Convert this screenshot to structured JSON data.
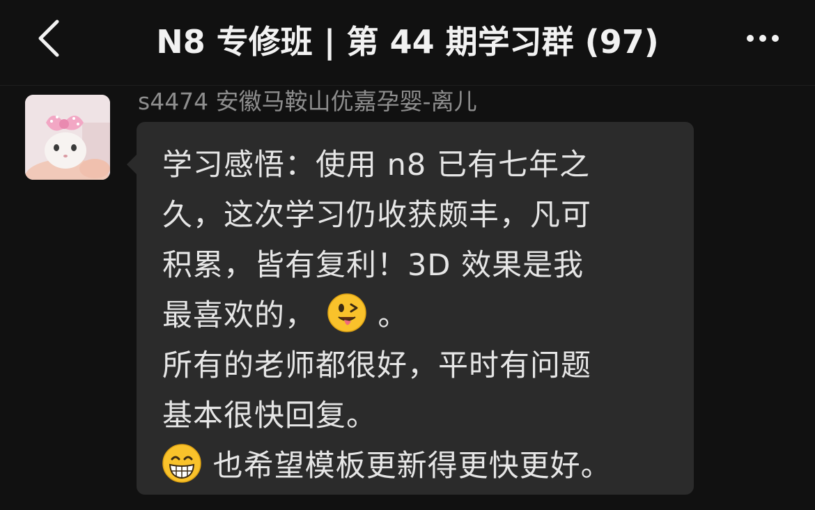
{
  "header": {
    "title": "N8 专修班 | 第 44 期学习群 (97)"
  },
  "message": {
    "sender": "s4474 安徽马鞍山优嘉孕婴-离儿",
    "lines": {
      "l1": "学习感悟：使用 n8 已有七年之",
      "l2": "久，这次学习仍收获颇丰，凡可",
      "l3": "积累，皆有复利！3D 效果是我",
      "l4": "最喜欢的，",
      "l4_end": "。",
      "l5": "所有的老师都很好，平时有问题",
      "l6": "基本很快回复。",
      "l7": "也希望模板更新得更快更好。"
    },
    "emojis": {
      "wink": "winking-face-with-tongue-icon",
      "grin": "grinning-face-icon"
    }
  },
  "colors": {
    "background": "#111111",
    "bubble": "#2b2b2b",
    "text": "#e6e6e6",
    "sender": "#8e8e8e"
  }
}
